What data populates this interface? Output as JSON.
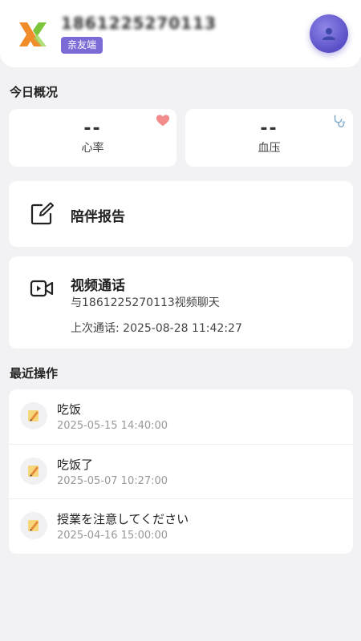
{
  "header": {
    "user_id": "1861225270113",
    "badge": "亲友端"
  },
  "overview": {
    "title": "今日概况",
    "heart_rate": {
      "value": "--",
      "label": "心率"
    },
    "blood_pressure": {
      "value": "--",
      "label": "血压"
    }
  },
  "report": {
    "label": "陪伴报告"
  },
  "video": {
    "title": "视频通话",
    "subtitle": "与18612252701​13视频聊天",
    "last_call": "上次通话: 2025-08-28 11:42:27"
  },
  "recent": {
    "title": "最近操作",
    "items": [
      {
        "title": "吃饭",
        "time": "2025-05-15 14:40:00"
      },
      {
        "title": "吃饭了",
        "time": "2025-05-07 10:27:00"
      },
      {
        "title": "授業を注意してください",
        "time": "2025-04-16 15:00:00"
      }
    ]
  },
  "colors": {
    "accent": "#7b6bd6",
    "logo_orange": "#f08c2a",
    "logo_green": "#7cc43a"
  }
}
